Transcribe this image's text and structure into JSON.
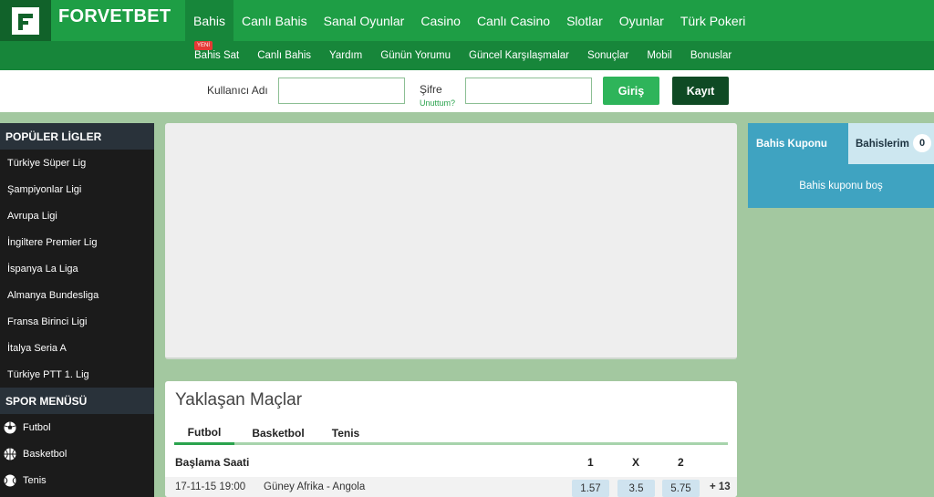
{
  "brand": {
    "name": "FORVETBET"
  },
  "main_nav": [
    "Bahis",
    "Canlı Bahis",
    "Sanal Oyunlar",
    "Casino",
    "Canlı Casino",
    "Slotlar",
    "Oyunlar",
    "Türk Pokeri"
  ],
  "sub_nav": {
    "new_badge": "YENİ",
    "items": [
      "Bahis Sat",
      "Canlı Bahis",
      "Yardım",
      "Günün Yorumu",
      "Güncel Karşılaşmalar",
      "Sonuçlar",
      "Mobil",
      "Bonuslar"
    ]
  },
  "login": {
    "username_label": "Kullanıcı Adı",
    "password_label": "Şifre",
    "forgot_link": "Unuttum?",
    "login_button": "Giriş",
    "register_button": "Kayıt"
  },
  "sidebar": {
    "popular_title": "POPÜLER LİGLER",
    "leagues": [
      "Türkiye Süper Lig",
      "Şampiyonlar Ligi",
      "Avrupa Ligi",
      "İngiltere Premier Lig",
      "İspanya La Liga",
      "Almanya Bundesliga",
      "Fransa Birinci Ligi",
      "İtalya Seria A",
      "Türkiye PTT 1. Lig"
    ],
    "sport_title": "SPOR MENÜSÜ",
    "sports": [
      {
        "label": "Futbol",
        "icon": "football-icon"
      },
      {
        "label": "Basketbol",
        "icon": "basketball-icon"
      },
      {
        "label": "Tenis",
        "icon": "tennis-icon"
      }
    ]
  },
  "upcoming": {
    "title": "Yaklaşan Maçlar",
    "tabs": [
      "Futbol",
      "Basketbol",
      "Tenis"
    ],
    "columns": {
      "start_time": "Başlama Saati",
      "home": "1",
      "draw": "X",
      "away": "2"
    },
    "rows": [
      {
        "time": "17-11-15 19:00",
        "match": "Güney Afrika - Angola",
        "odd1": "1.57",
        "oddx": "3.5",
        "odd2": "5.75",
        "more": "+ 13"
      }
    ]
  },
  "betslip": {
    "tab_coupon": "Bahis Kuponu",
    "tab_my_bets": "Bahislerim",
    "my_bets_count": "0",
    "empty_text": "Bahis kuponu boş"
  },
  "colors": {
    "header_green": "#1e9e45",
    "subnav_green": "#17863a",
    "logo_dark": "#11622a",
    "page_bg": "#a3c8a0",
    "sidebar_bg": "#1b1b1b",
    "betslip_blue": "#3fa3c1"
  }
}
